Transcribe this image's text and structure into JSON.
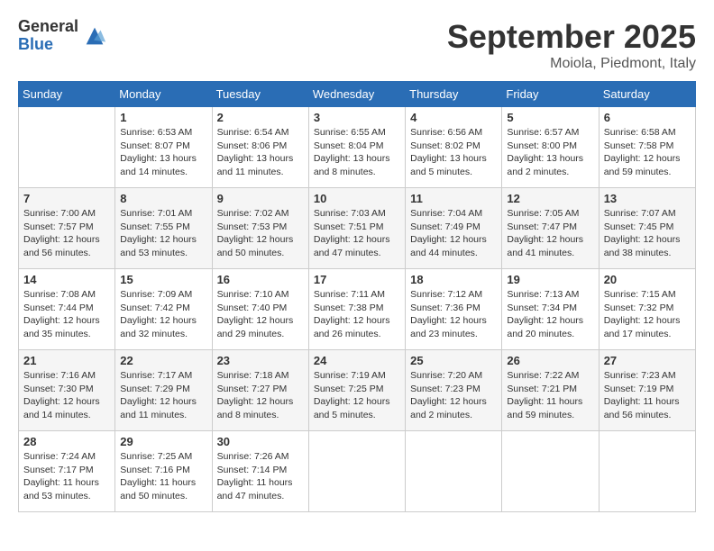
{
  "logo": {
    "general": "General",
    "blue": "Blue"
  },
  "title": {
    "month": "September 2025",
    "location": "Moiola, Piedmont, Italy"
  },
  "days_header": [
    "Sunday",
    "Monday",
    "Tuesday",
    "Wednesday",
    "Thursday",
    "Friday",
    "Saturday"
  ],
  "weeks": [
    [
      {
        "day": "",
        "info": ""
      },
      {
        "day": "1",
        "info": "Sunrise: 6:53 AM\nSunset: 8:07 PM\nDaylight: 13 hours\nand 14 minutes."
      },
      {
        "day": "2",
        "info": "Sunrise: 6:54 AM\nSunset: 8:06 PM\nDaylight: 13 hours\nand 11 minutes."
      },
      {
        "day": "3",
        "info": "Sunrise: 6:55 AM\nSunset: 8:04 PM\nDaylight: 13 hours\nand 8 minutes."
      },
      {
        "day": "4",
        "info": "Sunrise: 6:56 AM\nSunset: 8:02 PM\nDaylight: 13 hours\nand 5 minutes."
      },
      {
        "day": "5",
        "info": "Sunrise: 6:57 AM\nSunset: 8:00 PM\nDaylight: 13 hours\nand 2 minutes."
      },
      {
        "day": "6",
        "info": "Sunrise: 6:58 AM\nSunset: 7:58 PM\nDaylight: 12 hours\nand 59 minutes."
      }
    ],
    [
      {
        "day": "7",
        "info": "Sunrise: 7:00 AM\nSunset: 7:57 PM\nDaylight: 12 hours\nand 56 minutes."
      },
      {
        "day": "8",
        "info": "Sunrise: 7:01 AM\nSunset: 7:55 PM\nDaylight: 12 hours\nand 53 minutes."
      },
      {
        "day": "9",
        "info": "Sunrise: 7:02 AM\nSunset: 7:53 PM\nDaylight: 12 hours\nand 50 minutes."
      },
      {
        "day": "10",
        "info": "Sunrise: 7:03 AM\nSunset: 7:51 PM\nDaylight: 12 hours\nand 47 minutes."
      },
      {
        "day": "11",
        "info": "Sunrise: 7:04 AM\nSunset: 7:49 PM\nDaylight: 12 hours\nand 44 minutes."
      },
      {
        "day": "12",
        "info": "Sunrise: 7:05 AM\nSunset: 7:47 PM\nDaylight: 12 hours\nand 41 minutes."
      },
      {
        "day": "13",
        "info": "Sunrise: 7:07 AM\nSunset: 7:45 PM\nDaylight: 12 hours\nand 38 minutes."
      }
    ],
    [
      {
        "day": "14",
        "info": "Sunrise: 7:08 AM\nSunset: 7:44 PM\nDaylight: 12 hours\nand 35 minutes."
      },
      {
        "day": "15",
        "info": "Sunrise: 7:09 AM\nSunset: 7:42 PM\nDaylight: 12 hours\nand 32 minutes."
      },
      {
        "day": "16",
        "info": "Sunrise: 7:10 AM\nSunset: 7:40 PM\nDaylight: 12 hours\nand 29 minutes."
      },
      {
        "day": "17",
        "info": "Sunrise: 7:11 AM\nSunset: 7:38 PM\nDaylight: 12 hours\nand 26 minutes."
      },
      {
        "day": "18",
        "info": "Sunrise: 7:12 AM\nSunset: 7:36 PM\nDaylight: 12 hours\nand 23 minutes."
      },
      {
        "day": "19",
        "info": "Sunrise: 7:13 AM\nSunset: 7:34 PM\nDaylight: 12 hours\nand 20 minutes."
      },
      {
        "day": "20",
        "info": "Sunrise: 7:15 AM\nSunset: 7:32 PM\nDaylight: 12 hours\nand 17 minutes."
      }
    ],
    [
      {
        "day": "21",
        "info": "Sunrise: 7:16 AM\nSunset: 7:30 PM\nDaylight: 12 hours\nand 14 minutes."
      },
      {
        "day": "22",
        "info": "Sunrise: 7:17 AM\nSunset: 7:29 PM\nDaylight: 12 hours\nand 11 minutes."
      },
      {
        "day": "23",
        "info": "Sunrise: 7:18 AM\nSunset: 7:27 PM\nDaylight: 12 hours\nand 8 minutes."
      },
      {
        "day": "24",
        "info": "Sunrise: 7:19 AM\nSunset: 7:25 PM\nDaylight: 12 hours\nand 5 minutes."
      },
      {
        "day": "25",
        "info": "Sunrise: 7:20 AM\nSunset: 7:23 PM\nDaylight: 12 hours\nand 2 minutes."
      },
      {
        "day": "26",
        "info": "Sunrise: 7:22 AM\nSunset: 7:21 PM\nDaylight: 11 hours\nand 59 minutes."
      },
      {
        "day": "27",
        "info": "Sunrise: 7:23 AM\nSunset: 7:19 PM\nDaylight: 11 hours\nand 56 minutes."
      }
    ],
    [
      {
        "day": "28",
        "info": "Sunrise: 7:24 AM\nSunset: 7:17 PM\nDaylight: 11 hours\nand 53 minutes."
      },
      {
        "day": "29",
        "info": "Sunrise: 7:25 AM\nSunset: 7:16 PM\nDaylight: 11 hours\nand 50 minutes."
      },
      {
        "day": "30",
        "info": "Sunrise: 7:26 AM\nSunset: 7:14 PM\nDaylight: 11 hours\nand 47 minutes."
      },
      {
        "day": "",
        "info": ""
      },
      {
        "day": "",
        "info": ""
      },
      {
        "day": "",
        "info": ""
      },
      {
        "day": "",
        "info": ""
      }
    ]
  ]
}
